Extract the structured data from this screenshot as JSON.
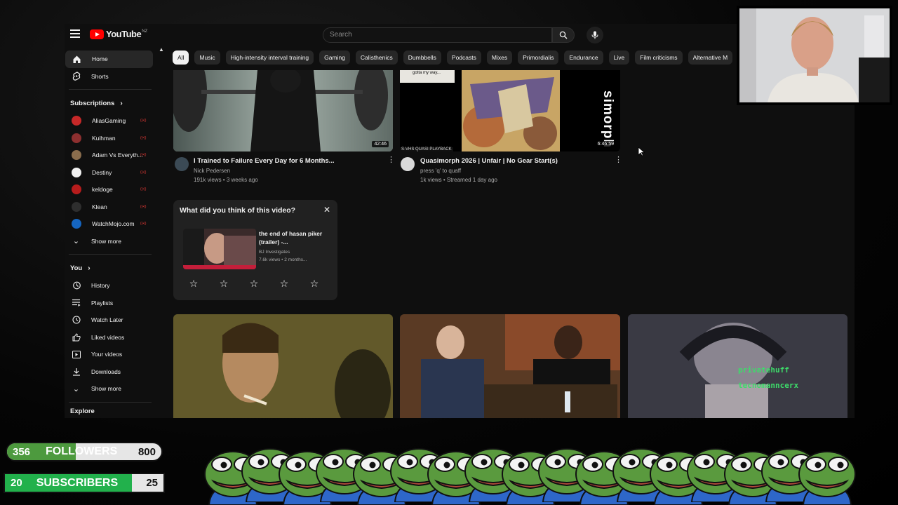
{
  "topbar": {
    "logo_text": "YouTube",
    "logo_region": "NZ",
    "search_placeholder": "Search"
  },
  "chips": [
    "All",
    "Music",
    "High-intensity interval training",
    "Gaming",
    "Calisthenics",
    "Dumbbells",
    "Podcasts",
    "Mixes",
    "Primordialis",
    "Endurance",
    "Live",
    "Film criticisms",
    "Alternative M"
  ],
  "sidebar": {
    "main": [
      {
        "label": "Home",
        "icon": "home-icon"
      },
      {
        "label": "Shorts",
        "icon": "shorts-icon"
      }
    ],
    "subscriptions_heading": "Subscriptions",
    "subscriptions": [
      {
        "label": "AliasGaming",
        "color": "#c62828"
      },
      {
        "label": "Kuihman",
        "color": "#8d2f2f"
      },
      {
        "label": "Adam Vs Everyth...",
        "color": "#8a6d4d"
      },
      {
        "label": "Destiny",
        "color": "#f1f1f1"
      },
      {
        "label": "keldoge",
        "color": "#b71c1c"
      },
      {
        "label": "Klean",
        "color": "#2e2e2e"
      },
      {
        "label": "WatchMojo.com",
        "color": "#1565c0"
      }
    ],
    "show_more_1": "Show more",
    "you_heading": "You",
    "you_items": [
      {
        "label": "History",
        "icon": "history-icon"
      },
      {
        "label": "Playlists",
        "icon": "playlists-icon"
      },
      {
        "label": "Watch Later",
        "icon": "watch-later-icon"
      },
      {
        "label": "Liked videos",
        "icon": "liked-icon"
      },
      {
        "label": "Your videos",
        "icon": "your-videos-icon"
      },
      {
        "label": "Downloads",
        "icon": "downloads-icon"
      }
    ],
    "show_more_2": "Show more",
    "explore_heading": "Explore"
  },
  "videos": [
    {
      "title": "I Trained to Failure Every Day for 6 Months...",
      "channel": "Nick Pedersen",
      "stats": "191k views • 3 weeks ago",
      "duration": "42:46"
    },
    {
      "title": "Quasimorph 2026 | Unfair | No Gear Start(s)",
      "channel": "press 'q' to quaff",
      "stats": "1k views • Streamed 1 day ago",
      "duration": "6:46:59",
      "thumb_text_left": "S-VHS QUASI PLAYBACK",
      "thumb_text_top": "gotta my way...",
      "thumb_text_right": "simorph"
    }
  ],
  "survey": {
    "question": "What did you think of this video?",
    "video_title": "the end of hasan piker (trailer) -...",
    "channel": "BJ Investigates",
    "stats": "7.6k views • 2 months..."
  },
  "overlay": {
    "chat_name_1": "privatehuff",
    "chat_name_2": "tecnomanncerx"
  },
  "stats": {
    "followers_current": "356",
    "followers_label": "FOLLOWERS",
    "followers_goal": "800",
    "followers_progress": 0.445,
    "subscribers_current": "20",
    "subscribers_label": "SUBSCRIBERS",
    "subscribers_goal": "25",
    "subscribers_progress": 0.8
  }
}
